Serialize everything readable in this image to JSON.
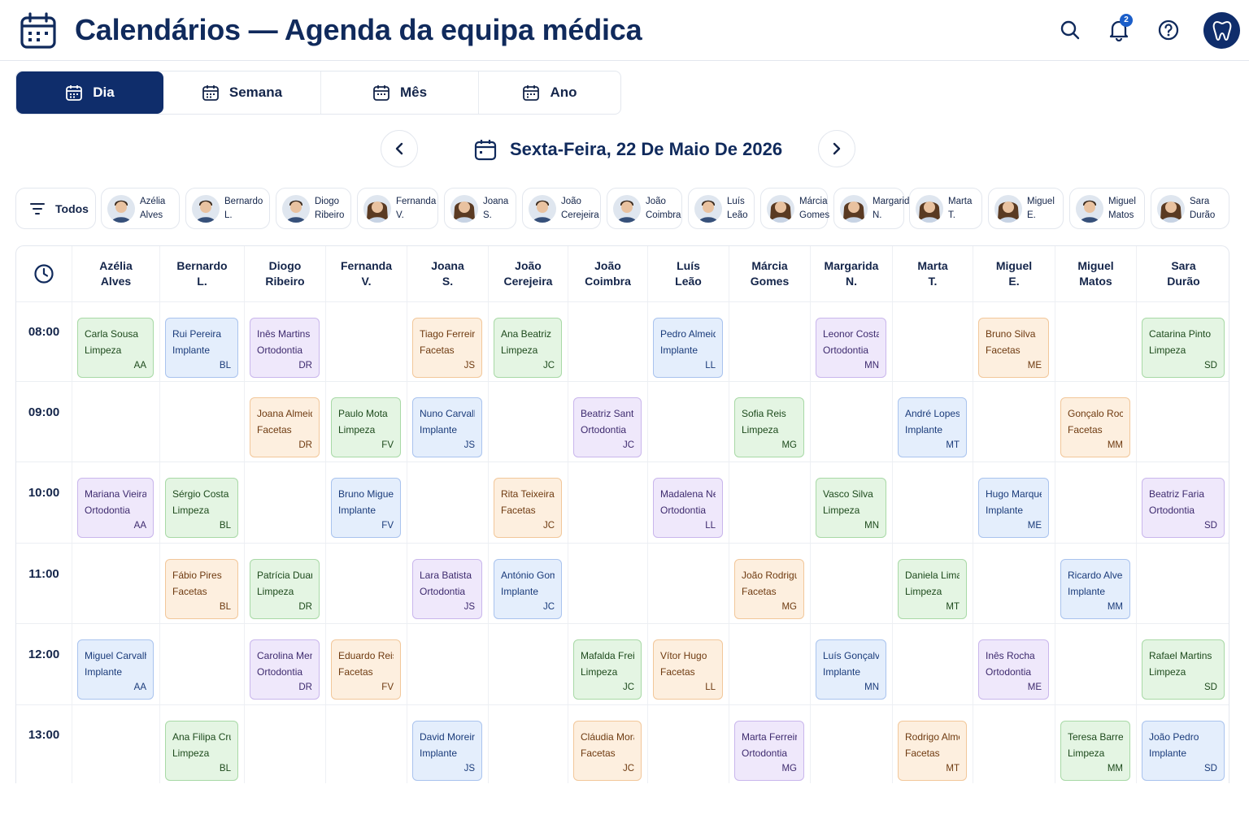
{
  "header": {
    "title": "Calendários — Agenda da equipa médica",
    "notification_count": "2",
    "icons": [
      "calendar-icon",
      "search-icon",
      "bell-icon",
      "help-icon",
      "tooth-icon"
    ]
  },
  "view_tabs": [
    {
      "label": "Dia",
      "active": true
    },
    {
      "label": "Semana",
      "active": false
    },
    {
      "label": "Mês",
      "active": false
    },
    {
      "label": "Ano",
      "active": false
    }
  ],
  "date_nav": {
    "label": "Sexta-Feira, 22 De Maio De 2026"
  },
  "filters": {
    "all_label": "Todos",
    "staff": [
      {
        "line1": "Azélia",
        "line2": "Alves",
        "gender": "m"
      },
      {
        "line1": "Bernardo",
        "line2": "L.",
        "gender": "m"
      },
      {
        "line1": "Diogo",
        "line2": "Ribeiro",
        "gender": "m"
      },
      {
        "line1": "Fernanda",
        "line2": "V.",
        "gender": "f"
      },
      {
        "line1": "Joana",
        "line2": "S.",
        "gender": "f"
      },
      {
        "line1": "João",
        "line2": "Cerejeira",
        "gender": "m"
      },
      {
        "line1": "João",
        "line2": "Coimbra",
        "gender": "m"
      },
      {
        "line1": "Luís",
        "line2": "Leão",
        "gender": "m"
      },
      {
        "line1": "Márcia",
        "line2": "Gomes",
        "gender": "f"
      },
      {
        "line1": "Margarida",
        "line2": "N.",
        "gender": "f"
      },
      {
        "line1": "Marta",
        "line2": "T.",
        "gender": "f"
      },
      {
        "line1": "Miguel",
        "line2": "E.",
        "gender": "f"
      },
      {
        "line1": "Miguel",
        "line2": "Matos",
        "gender": "m"
      },
      {
        "line1": "Sara",
        "line2": "Durão",
        "gender": "f"
      }
    ]
  },
  "columns": [
    {
      "line1": "Azélia",
      "line2": "Alves"
    },
    {
      "line1": "Bernardo",
      "line2": "L."
    },
    {
      "line1": "Diogo",
      "line2": "Ribeiro"
    },
    {
      "line1": "Fernanda",
      "line2": "V."
    },
    {
      "line1": "Joana",
      "line2": "S."
    },
    {
      "line1": "João",
      "line2": "Cerejeira"
    },
    {
      "line1": "João",
      "line2": "Coimbra"
    },
    {
      "line1": "Luís",
      "line2": "Leão"
    },
    {
      "line1": "Márcia",
      "line2": "Gomes"
    },
    {
      "line1": "Margarida",
      "line2": "N."
    },
    {
      "line1": "Marta",
      "line2": "T."
    },
    {
      "line1": "Miguel",
      "line2": "E."
    },
    {
      "line1": "Miguel",
      "line2": "Matos"
    },
    {
      "line1": "Sara",
      "line2": "Durão"
    }
  ],
  "times": [
    "08:00",
    "09:00",
    "10:00",
    "11:00",
    "12:00",
    "13:00"
  ],
  "colors": {
    "Limpeza": "green",
    "Implante": "blue",
    "Ortodontia": "purple",
    "Facetas": "orange",
    "accent": "#0f2d6b"
  },
  "appointments": [
    {
      "col": 0,
      "slot": 0,
      "patient": "Carla Sousa",
      "procedure": "Limpeza",
      "initials": "AA"
    },
    {
      "col": 1,
      "slot": 0,
      "patient": "Rui Pereira",
      "procedure": "Implante",
      "initials": "BL"
    },
    {
      "col": 2,
      "slot": 0,
      "patient": "Inês Martins",
      "procedure": "Ortodontia",
      "initials": "DR"
    },
    {
      "col": 4,
      "slot": 0,
      "patient": "Tiago Ferreira",
      "procedure": "Facetas",
      "initials": "JS"
    },
    {
      "col": 5,
      "slot": 0,
      "patient": "Ana Beatriz",
      "procedure": "Limpeza",
      "initials": "JC"
    },
    {
      "col": 7,
      "slot": 0,
      "patient": "Pedro Almeida",
      "procedure": "Implante",
      "initials": "LL"
    },
    {
      "col": 9,
      "slot": 0,
      "patient": "Leonor Costa",
      "procedure": "Ortodontia",
      "initials": "MN"
    },
    {
      "col": 11,
      "slot": 0,
      "patient": "Bruno Silva",
      "procedure": "Facetas",
      "initials": "ME"
    },
    {
      "col": 13,
      "slot": 0,
      "patient": "Catarina Pinto",
      "procedure": "Limpeza",
      "initials": "SD"
    },
    {
      "col": 2,
      "slot": 1,
      "patient": "Joana Almeida",
      "procedure": "Facetas",
      "initials": "DR"
    },
    {
      "col": 3,
      "slot": 1,
      "patient": "Paulo Mota",
      "procedure": "Limpeza",
      "initials": "FV"
    },
    {
      "col": 4,
      "slot": 1,
      "patient": "Nuno Carvalho",
      "procedure": "Implante",
      "initials": "JS"
    },
    {
      "col": 6,
      "slot": 1,
      "patient": "Beatriz Santos",
      "procedure": "Ortodontia",
      "initials": "JC"
    },
    {
      "col": 8,
      "slot": 1,
      "patient": "Sofia Reis",
      "procedure": "Limpeza",
      "initials": "MG"
    },
    {
      "col": 10,
      "slot": 1,
      "patient": "André Lopes",
      "procedure": "Implante",
      "initials": "MT"
    },
    {
      "col": 12,
      "slot": 1,
      "patient": "Gonçalo Rocha",
      "procedure": "Facetas",
      "initials": "MM"
    },
    {
      "col": 0,
      "slot": 2,
      "patient": "Mariana Vieira",
      "procedure": "Ortodontia",
      "initials": "AA"
    },
    {
      "col": 1,
      "slot": 2,
      "patient": "Sérgio Costa",
      "procedure": "Limpeza",
      "initials": "BL"
    },
    {
      "col": 3,
      "slot": 2,
      "patient": "Bruno Miguel",
      "procedure": "Implante",
      "initials": "FV"
    },
    {
      "col": 5,
      "slot": 2,
      "patient": "Rita Teixeira",
      "procedure": "Facetas",
      "initials": "JC"
    },
    {
      "col": 7,
      "slot": 2,
      "patient": "Madalena Neves",
      "procedure": "Ortodontia",
      "initials": "LL"
    },
    {
      "col": 9,
      "slot": 2,
      "patient": "Vasco Silva",
      "procedure": "Limpeza",
      "initials": "MN"
    },
    {
      "col": 11,
      "slot": 2,
      "patient": "Hugo Marques",
      "procedure": "Implante",
      "initials": "ME"
    },
    {
      "col": 13,
      "slot": 2,
      "patient": "Beatriz Faria",
      "procedure": "Ortodontia",
      "initials": "SD"
    },
    {
      "col": 1,
      "slot": 3,
      "patient": "Fábio Pires",
      "procedure": "Facetas",
      "initials": "BL"
    },
    {
      "col": 2,
      "slot": 3,
      "patient": "Patrícia Duarte",
      "procedure": "Limpeza",
      "initials": "DR"
    },
    {
      "col": 4,
      "slot": 3,
      "patient": "Lara Batista",
      "procedure": "Ortodontia",
      "initials": "JS"
    },
    {
      "col": 5,
      "slot": 3,
      "patient": "António Gomes",
      "procedure": "Implante",
      "initials": "JC"
    },
    {
      "col": 8,
      "slot": 3,
      "patient": "João Rodrigues",
      "procedure": "Facetas",
      "initials": "MG"
    },
    {
      "col": 10,
      "slot": 3,
      "patient": "Daniela Lima",
      "procedure": "Limpeza",
      "initials": "MT"
    },
    {
      "col": 12,
      "slot": 3,
      "patient": "Ricardo Alves",
      "procedure": "Implante",
      "initials": "MM"
    },
    {
      "col": 0,
      "slot": 4,
      "patient": "Miguel Carvalhal",
      "procedure": "Implante",
      "initials": "AA"
    },
    {
      "col": 2,
      "slot": 4,
      "patient": "Carolina Mendes",
      "procedure": "Ortodontia",
      "initials": "DR"
    },
    {
      "col": 3,
      "slot": 4,
      "patient": "Eduardo Reis",
      "procedure": "Facetas",
      "initials": "FV"
    },
    {
      "col": 6,
      "slot": 4,
      "patient": "Mafalda Freitas",
      "procedure": "Limpeza",
      "initials": "JC"
    },
    {
      "col": 7,
      "slot": 4,
      "patient": "Vítor Hugo",
      "procedure": "Facetas",
      "initials": "LL"
    },
    {
      "col": 9,
      "slot": 4,
      "patient": "Luís Gonçalves",
      "procedure": "Implante",
      "initials": "MN"
    },
    {
      "col": 11,
      "slot": 4,
      "patient": "Inês Rocha",
      "procedure": "Ortodontia",
      "initials": "ME"
    },
    {
      "col": 13,
      "slot": 4,
      "patient": "Rafael Martins",
      "procedure": "Limpeza",
      "initials": "SD"
    },
    {
      "col": 1,
      "slot": 5,
      "patient": "Ana Filipa Cruz",
      "procedure": "Limpeza",
      "initials": "BL"
    },
    {
      "col": 4,
      "slot": 5,
      "patient": "David Moreira",
      "procedure": "Implante",
      "initials": "JS"
    },
    {
      "col": 6,
      "slot": 5,
      "patient": "Cláudia Morais",
      "procedure": "Facetas",
      "initials": "JC"
    },
    {
      "col": 8,
      "slot": 5,
      "patient": "Marta Ferreira",
      "procedure": "Ortodontia",
      "initials": "MG"
    },
    {
      "col": 10,
      "slot": 5,
      "patient": "Rodrigo Almeida",
      "procedure": "Facetas",
      "initials": "MT"
    },
    {
      "col": 12,
      "slot": 5,
      "patient": "Teresa Barreto",
      "procedure": "Limpeza",
      "initials": "MM"
    },
    {
      "col": 13,
      "slot": 5,
      "patient": "João Pedro",
      "procedure": "Implante",
      "initials": "SD"
    }
  ]
}
